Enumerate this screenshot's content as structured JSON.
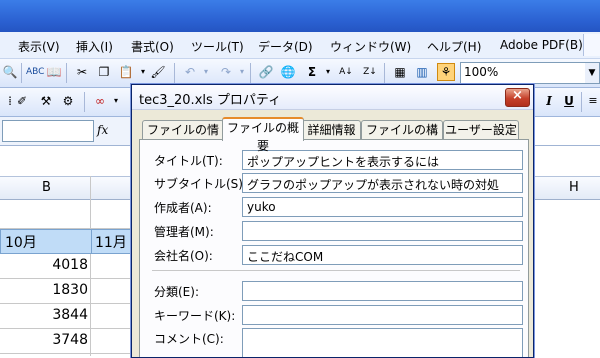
{
  "menubar": {
    "items": [
      "表示(V)",
      "挿入(I)",
      "書式(O)",
      "ツール(T)",
      "データ(D)",
      "ウィンドウ(W)",
      "ヘルプ(H)",
      "Adobe PDF(B)"
    ]
  },
  "toolbar": {
    "zoom_value": "100%",
    "sum_symbol": "Σ"
  },
  "formula_bar": {
    "fx_label": "fx"
  },
  "sheet": {
    "column_b": "B",
    "column_h": "H",
    "header_oct": "10月",
    "header_nov": "11月",
    "values": [
      "4018",
      "1830",
      "3844",
      "3748"
    ]
  },
  "toolbar_right": {
    "italic": "I",
    "underline": "U"
  },
  "dialog": {
    "title": "tec3_20.xls プロパティ",
    "close_symbol": "×",
    "tabs": [
      "ファイルの情報",
      "ファイルの概要",
      "詳細情報",
      "ファイルの構成",
      "ユーザー設定"
    ],
    "active_tab_index": 1,
    "fields": {
      "title_label": "タイトル(T):",
      "title_value": "ポップアップヒントを表示するには",
      "subtitle_label": "サブタイトル(S):",
      "subtitle_value": "グラフのポップアップが表示されない時の対処",
      "author_label": "作成者(A):",
      "author_value": "yuko",
      "manager_label": "管理者(M):",
      "manager_value": "",
      "company_label": "会社名(O):",
      "company_value": "ここだねCOM",
      "category_label": "分類(E):",
      "category_value": "",
      "keywords_label": "キーワード(K):",
      "keywords_value": "",
      "comments_label": "コメント(C):"
    }
  },
  "colors": {
    "menu_bg": "#eaf1fd",
    "dialog_bg": "#ece9d8",
    "selected_header": "#c0dcf7",
    "active_tab_accent": "#e68b2c"
  }
}
